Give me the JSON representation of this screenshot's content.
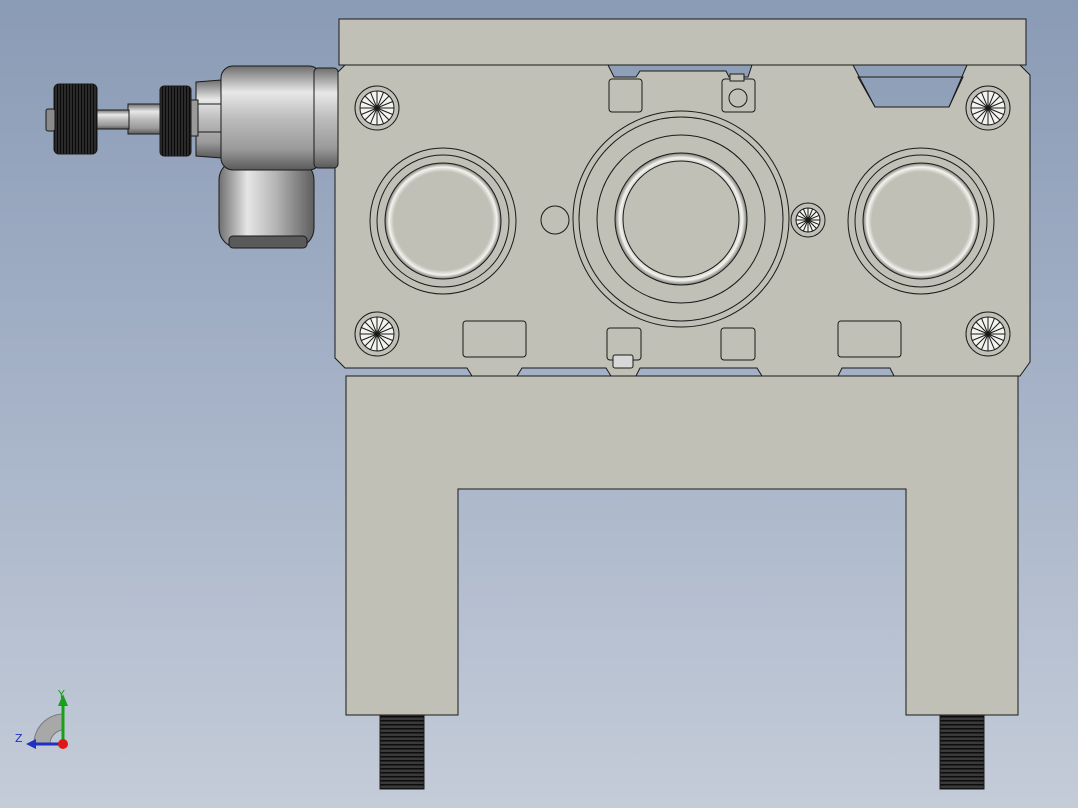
{
  "viewport": {
    "background_top": "#8a9bb5",
    "background_bottom": "#c4ccd8"
  },
  "model": {
    "part_fill": "#c0c0b6",
    "edge_color": "#1a1a1a",
    "fitting_metal": "#b8b8b8",
    "knurl_color": "#1a1a1a"
  },
  "triad": {
    "y_label": "Y",
    "z_label": "Z",
    "y_color": "#18a018",
    "z_color": "#2030c0",
    "x_color": "#e01818"
  }
}
